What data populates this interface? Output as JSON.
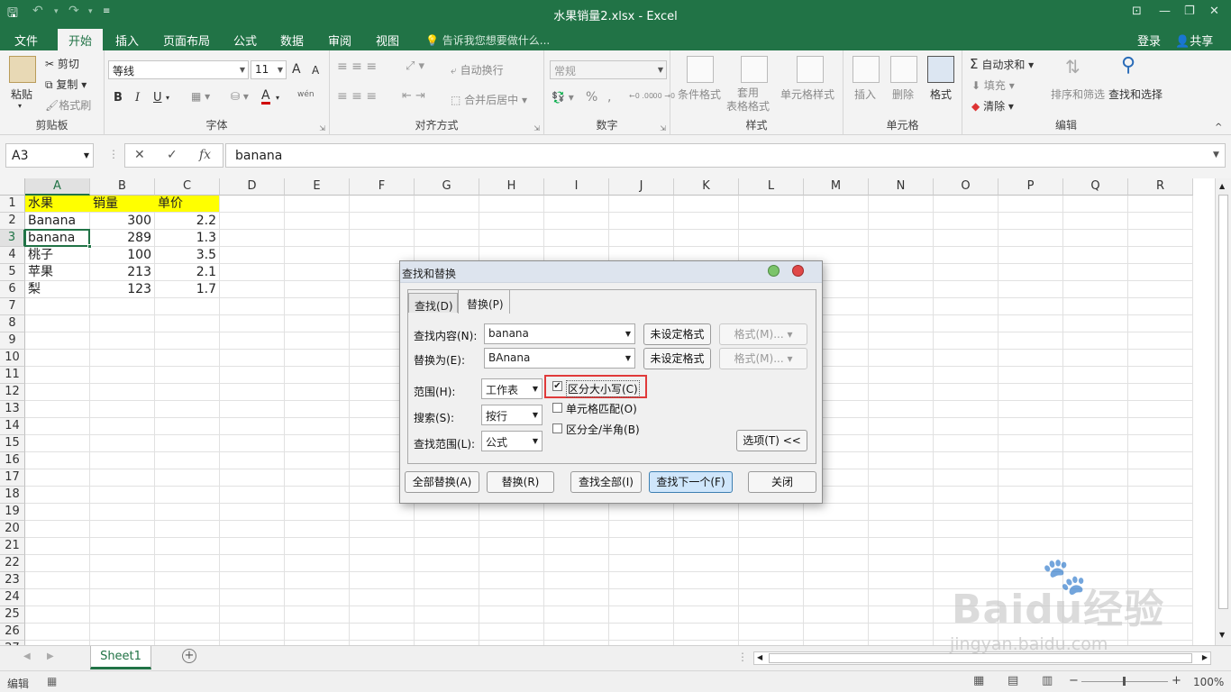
{
  "window": {
    "title": "水果销量2.xlsx - Excel",
    "icons": {
      "save": "save-icon",
      "undo": "undo-icon",
      "redo": "redo-icon",
      "customize": "customize-quick-access-icon"
    }
  },
  "menu": {
    "tabs": [
      "文件",
      "开始",
      "插入",
      "页面布局",
      "公式",
      "数据",
      "审阅",
      "视图"
    ],
    "active_tab": "开始",
    "tell_me": "告诉我您想要做什么...",
    "login": "登录",
    "share": "共享"
  },
  "ribbon": {
    "clipboard": {
      "label": "剪贴板",
      "paste": "粘贴",
      "cut": "剪切",
      "copy": "复制",
      "format_painter": "格式刷"
    },
    "font": {
      "label": "字体",
      "font_name": "等线",
      "font_size": "11",
      "grow": "A",
      "shrink": "A",
      "bold": "B",
      "italic": "I",
      "underline": "U",
      "font_color": "A",
      "phonetic": "wén"
    },
    "alignment": {
      "label": "对齐方式",
      "wrap": "自动换行",
      "merge": "合并后居中"
    },
    "number": {
      "label": "数字",
      "format": "常规",
      "percent": "%",
      "comma": ",",
      "inc_dec": "←0 .00",
      "dec_dec": ".00 →0"
    },
    "styles": {
      "label": "样式",
      "conditional": "条件格式",
      "table_format": "套用\n表格格式",
      "cell_styles": "单元格样式"
    },
    "cells": {
      "label": "单元格",
      "insert": "插入",
      "delete": "删除",
      "format": "格式"
    },
    "editing": {
      "label": "编辑",
      "autosum": "自动求和",
      "fill": "填充",
      "clear": "清除",
      "sort_filter": "排序和筛选",
      "find_select": "查找和选择"
    }
  },
  "formula_bar": {
    "name_box": "A3",
    "formula": "banana",
    "cancel": "✕",
    "enter": "✓",
    "fx": "fx"
  },
  "sheet": {
    "columns": [
      "A",
      "B",
      "C",
      "D",
      "E",
      "F",
      "G",
      "H",
      "I",
      "J",
      "K",
      "L",
      "M",
      "N",
      "O",
      "P",
      "Q",
      "R"
    ],
    "rows": [
      "1",
      "2",
      "3",
      "4",
      "5",
      "6",
      "7",
      "8",
      "9",
      "10",
      "11",
      "12",
      "13",
      "14",
      "15",
      "16",
      "17",
      "18",
      "19",
      "20",
      "21",
      "22",
      "23",
      "24",
      "25",
      "26",
      "27"
    ],
    "selected_cell": "A3",
    "data": [
      [
        "水果",
        "销量",
        "单价"
      ],
      [
        "Banana",
        "300",
        "2.2"
      ],
      [
        "banana",
        "289",
        "1.3"
      ],
      [
        "桃子",
        "100",
        "3.5"
      ],
      [
        "苹果",
        "213",
        "2.1"
      ],
      [
        "梨",
        "123",
        "1.7"
      ]
    ],
    "header_fill": "#ffff00",
    "tabs": [
      "Sheet1"
    ]
  },
  "status": {
    "mode": "编辑",
    "zoom": "100%",
    "minus": "−",
    "plus": "+"
  },
  "dialog": {
    "title": "查找和替换",
    "tabs": [
      "查找(D)",
      "替换(P)"
    ],
    "active_tab": "替换(P)",
    "find_label": "查找内容(N):",
    "find_value": "banana",
    "replace_label": "替换为(E):",
    "replace_value": "BAnana",
    "no_format": "未设定格式",
    "format_btn": "格式(M)...",
    "within_label": "范围(H):",
    "within_value": "工作表",
    "search_label": "搜索(S):",
    "search_value": "按行",
    "lookin_label": "查找范围(L):",
    "lookin_value": "公式",
    "match_case": {
      "label": "区分大小写(C)",
      "checked": true
    },
    "match_entire": {
      "label": "单元格匹配(O)",
      "checked": false
    },
    "match_byte": {
      "label": "区分全/半角(B)",
      "checked": false
    },
    "options": "选项(T) <<",
    "replace_all": "全部替换(A)",
    "replace": "替换(R)",
    "find_all": "查找全部(I)",
    "find_next": "查找下一个(F)",
    "close": "关闭",
    "highlight_color": "#e03a3a"
  },
  "watermark": {
    "brand": "Baidu经验",
    "url": "jingyan.baidu.com"
  }
}
